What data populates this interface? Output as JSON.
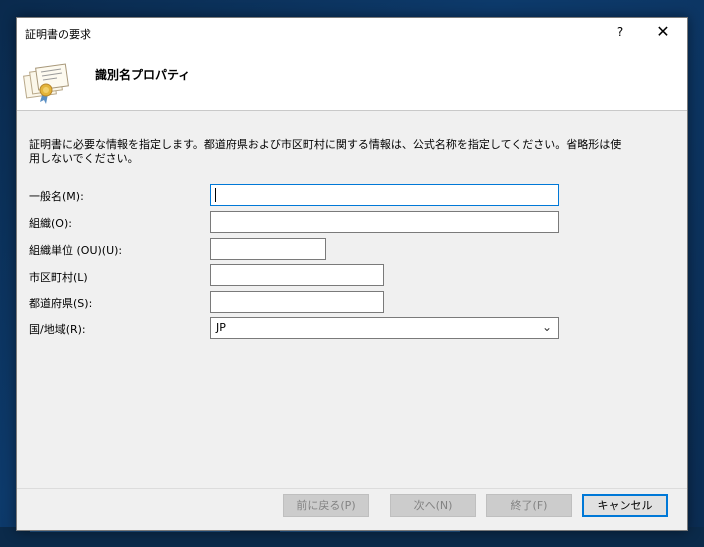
{
  "window": {
    "title": "証明書の要求",
    "help_label": "?",
    "close_label": "✕"
  },
  "header": {
    "title": "識別名プロパティ",
    "icon": "certificate-icon"
  },
  "description": "証明書に必要な情報を指定します。都道府県および市区町村に関する情報は、公式名称を指定してください。省略形は使用しないでください。",
  "fields": {
    "common_name": {
      "label": "一般名(M):",
      "value": ""
    },
    "organization": {
      "label": "組織(O):",
      "value": ""
    },
    "org_unit": {
      "label": "組織単位 (OU)(U):",
      "value": ""
    },
    "city": {
      "label": "市区町村(L)",
      "value": ""
    },
    "state": {
      "label": "都道府県(S):",
      "value": ""
    },
    "country": {
      "label": "国/地域(R):",
      "value": "JP"
    }
  },
  "buttons": {
    "back": "前に戻る(P)",
    "next": "次へ(N)",
    "finish": "終了(F)",
    "cancel": "キャンセル"
  },
  "colors": {
    "focus": "#0078d7",
    "dialog_bg": "#f0f0f0"
  }
}
